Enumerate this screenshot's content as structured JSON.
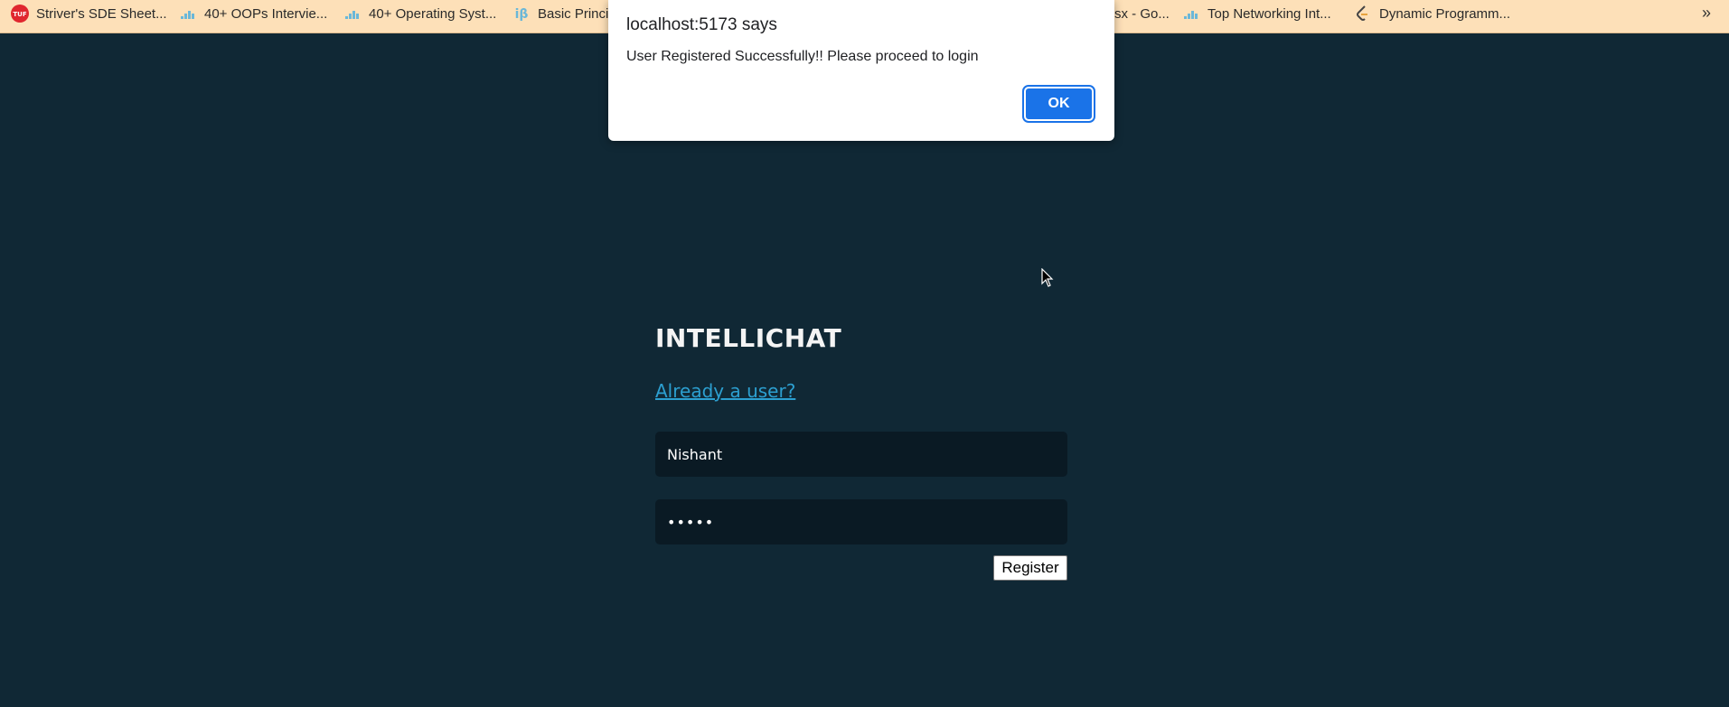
{
  "bookmarks": {
    "items": [
      {
        "label": "Striver's SDE Sheet...",
        "icon": "tuf-logo-icon"
      },
      {
        "label": "40+ OOPs Intervie...",
        "icon": "interviewbit-icon"
      },
      {
        "label": "40+ Operating Syst...",
        "icon": "interviewbit-icon"
      },
      {
        "label": "Basic Princi",
        "icon": "ib-icon"
      },
      {
        "label": "sx - Go...",
        "icon": "none"
      },
      {
        "label": "Top Networking Int...",
        "icon": "interviewbit-icon"
      },
      {
        "label": "Dynamic Programm...",
        "icon": "leetcode-icon"
      }
    ],
    "more_label": "»"
  },
  "app": {
    "title": "INTELLICHAT",
    "already_user_link": "Already a user?",
    "username_value": "Nishant",
    "password_value": "•••••",
    "register_label": "Register"
  },
  "dialog": {
    "title": "localhost:5173 says",
    "message": "User Registered Successfully!! Please proceed to login",
    "ok_label": "OK"
  },
  "colors": {
    "background": "#102835",
    "bookmarks_bar": "#fde0b8",
    "link": "#2c9fd0",
    "ok_button": "#1a73e8"
  }
}
